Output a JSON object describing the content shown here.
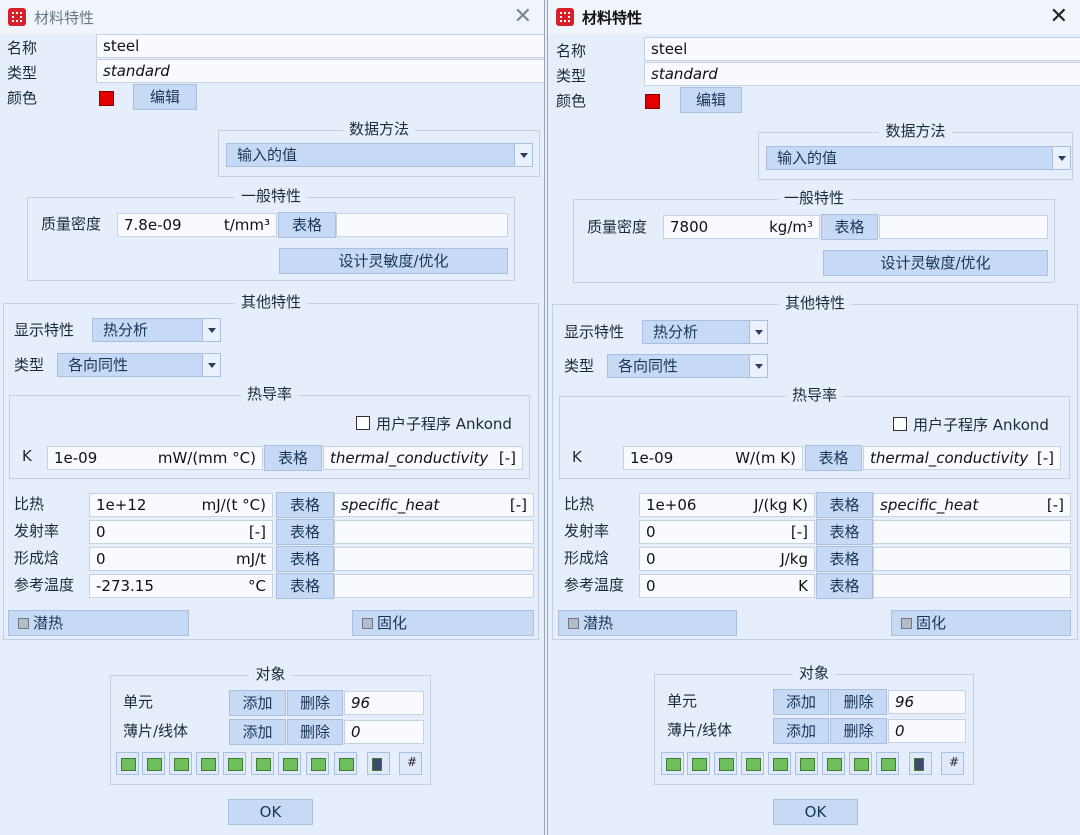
{
  "left": {
    "title": "材料特性",
    "close": "✕",
    "name_label": "名称",
    "name_value": "steel",
    "type_label": "类型",
    "type_value": "standard",
    "color_label": "颜色",
    "color_swatch": "#e30000",
    "edit_label": "编辑",
    "data_method": {
      "title": "数据方法",
      "value": "输入的值"
    },
    "general": {
      "title": "一般特性",
      "density_label": "质量密度",
      "density_value": "7.8e-09",
      "density_unit": "t/mm³",
      "table_label": "表格",
      "sensitivity_label": "设计灵敏度/优化"
    },
    "other": {
      "title": "其他特性",
      "display_label": "显示特性",
      "display_value": "热分析",
      "type_label": "类型",
      "type_value": "各向同性"
    },
    "thermal": {
      "title": "热导率",
      "subroutine_label": "用户子程序 Ankond",
      "k_label": "K",
      "k_value": "1e-09",
      "k_unit": "mW/(mm °C)",
      "table_label": "表格",
      "k_ref": "thermal_conductivity",
      "k_ref_unit": "[-]"
    },
    "rows": [
      {
        "label": "比热",
        "value": "1e+12",
        "unit": "mJ/(t °C)",
        "table": "表格",
        "ref": "specific_heat",
        "ref_unit": "[-]"
      },
      {
        "label": "发射率",
        "value": "0",
        "unit": "[-]",
        "table": "表格",
        "ref": "",
        "ref_unit": ""
      },
      {
        "label": "形成焓",
        "value": "0",
        "unit": "mJ/t",
        "table": "表格",
        "ref": "",
        "ref_unit": ""
      },
      {
        "label": "参考温度",
        "value": "-273.15",
        "unit": "°C",
        "table": "表格",
        "ref": "",
        "ref_unit": ""
      }
    ],
    "latent_label": "潜热",
    "cure_label": "固化",
    "objects": {
      "title": "对象",
      "elem_label": "单元",
      "shell_label": "薄片/线体",
      "add_label": "添加",
      "del_label": "删除",
      "elem_count": "96",
      "shell_count": "0"
    },
    "ok_label": "OK"
  },
  "right": {
    "title": "材料特性",
    "close": "✕",
    "name_label": "名称",
    "name_value": "steel",
    "type_label": "类型",
    "type_value": "standard",
    "color_label": "颜色",
    "color_swatch": "#e30000",
    "edit_label": "编辑",
    "data_method": {
      "title": "数据方法",
      "value": "输入的值"
    },
    "general": {
      "title": "一般特性",
      "density_label": "质量密度",
      "density_value": "7800",
      "density_unit": "kg/m³",
      "table_label": "表格",
      "sensitivity_label": "设计灵敏度/优化"
    },
    "other": {
      "title": "其他特性",
      "display_label": "显示特性",
      "display_value": "热分析",
      "type_label": "类型",
      "type_value": "各向同性"
    },
    "thermal": {
      "title": "热导率",
      "subroutine_label": "用户子程序 Ankond",
      "k_label": "K",
      "k_value": "1e-09",
      "k_unit": "W/(m K)",
      "table_label": "表格",
      "k_ref": "thermal_conductivity",
      "k_ref_unit": "[-]"
    },
    "rows": [
      {
        "label": "比热",
        "value": "1e+06",
        "unit": "J/(kg K)",
        "table": "表格",
        "ref": "specific_heat",
        "ref_unit": "[-]"
      },
      {
        "label": "发射率",
        "value": "0",
        "unit": "[-]",
        "table": "表格",
        "ref": "",
        "ref_unit": ""
      },
      {
        "label": "形成焓",
        "value": "0",
        "unit": "J/kg",
        "table": "表格",
        "ref": "",
        "ref_unit": ""
      },
      {
        "label": "参考温度",
        "value": "0",
        "unit": "K",
        "table": "表格",
        "ref": "",
        "ref_unit": ""
      }
    ],
    "latent_label": "潜热",
    "cure_label": "固化",
    "objects": {
      "title": "对象",
      "elem_label": "单元",
      "shell_label": "薄片/线体",
      "add_label": "添加",
      "del_label": "删除",
      "elem_count": "96",
      "shell_count": "0"
    },
    "ok_label": "OK"
  },
  "toolbar_icons": [
    "select-elements-icon",
    "select-front-icon",
    "select-back-icon",
    "select-box-icon",
    "select-node-icon",
    "select-grid-icon",
    "select-region-icon",
    "select-plane-icon",
    "select-surface-icon",
    "pick-list-icon",
    "grid-icon"
  ]
}
